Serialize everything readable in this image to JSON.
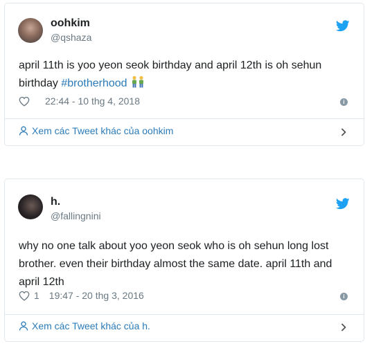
{
  "tweets": [
    {
      "display_name": "oohkim",
      "handle": "@qshaza",
      "text_before": "april 11th is yoo yeon seok birthday and april 12th is oh sehun birthday ",
      "hashtag": "#brotherhood",
      "emoji": "twin-people-emoji",
      "like_count": "",
      "timestamp": "22:44 - 10 thg 4, 2018",
      "more_link": "Xem các Tweet khác của oohkim"
    },
    {
      "display_name": "h.",
      "handle": "@fallingnini",
      "text": "why no one talk about yoo yeon seok who is oh sehun long lost brother. even their birthday almost the same date. april 11th and april 12th",
      "like_count": "1",
      "timestamp": "19:47 - 20 thg 3, 2016",
      "more_link": "Xem các Tweet khác của h."
    }
  ],
  "icons": {
    "bird": "twitter-bird-icon",
    "heart": "heart-outline-icon",
    "info": "info-icon",
    "person": "person-icon",
    "chevron": "chevron-right-icon"
  },
  "colors": {
    "twitter_blue": "#1da1f2",
    "link_blue": "#2b7bb9",
    "muted_gray": "#697882",
    "border": "#e1e8ed"
  }
}
